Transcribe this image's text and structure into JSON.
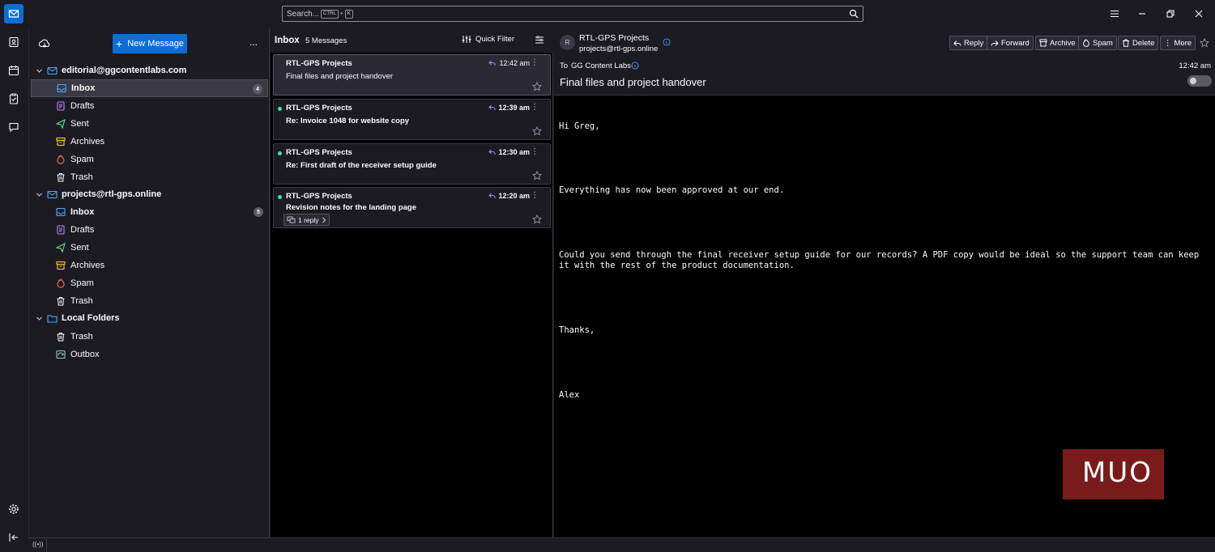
{
  "search": {
    "placeholder": "Search...",
    "kbd_ctrl": "CTRL",
    "kbd_plus": "+",
    "kbd_k": "K"
  },
  "folders_pane": {
    "new_message_label": "New Message",
    "more_label": "...",
    "accounts": [
      {
        "email": "editorial@ggcontentlabs.com",
        "folders": [
          {
            "label": "Inbox",
            "count": "4",
            "icon": "inbox-icon"
          },
          {
            "label": "Drafts",
            "icon": "drafts-icon"
          },
          {
            "label": "Sent",
            "icon": "sent-icon"
          },
          {
            "label": "Archives",
            "icon": "archive-icon"
          },
          {
            "label": "Spam",
            "icon": "spam-icon"
          },
          {
            "label": "Trash",
            "icon": "trash-icon"
          }
        ]
      },
      {
        "email": "projects@rtl-gps.online",
        "folders": [
          {
            "label": "Inbox",
            "count": "5",
            "icon": "inbox-icon"
          },
          {
            "label": "Drafts",
            "icon": "drafts-icon"
          },
          {
            "label": "Sent",
            "icon": "sent-icon"
          },
          {
            "label": "Archives",
            "icon": "archive-icon"
          },
          {
            "label": "Spam",
            "icon": "spam-icon"
          },
          {
            "label": "Trash",
            "icon": "trash-icon"
          }
        ]
      },
      {
        "email": "Local Folders",
        "folders": [
          {
            "label": "Trash",
            "icon": "trash-icon"
          },
          {
            "label": "Outbox",
            "icon": "outbox-icon"
          }
        ]
      }
    ]
  },
  "message_list": {
    "folder_title": "Inbox",
    "count_label": "5 Messages",
    "quick_filter_label": "Quick Filter",
    "messages": [
      {
        "sender": "RTL-GPS Projects",
        "subject": "Final files and project handover",
        "time": "12:42 am",
        "unread": false,
        "selected": true
      },
      {
        "sender": "RTL-GPS Projects",
        "subject": "Re: Invoice 1048 for website copy",
        "time": "12:39 am",
        "unread": true
      },
      {
        "sender": "RTL-GPS Projects",
        "subject": "Re: First draft of the receiver setup guide",
        "time": "12:30 am",
        "unread": true
      },
      {
        "sender": "RTL-GPS Projects",
        "subject": "Revision notes for the landing page",
        "time": "12:20 am",
        "unread": true,
        "thread_label": "1 reply"
      }
    ]
  },
  "reader": {
    "avatar_letter": "R",
    "from_name": "RTL-GPS Projects",
    "from_email": "projects@rtl-gps.online",
    "to_label": "To",
    "to_name": "GG Content Labs",
    "time": "12:42 am",
    "subject": "Final files and project handover",
    "actions": {
      "reply": "Reply",
      "forward": "Forward",
      "archive": "Archive",
      "spam": "Spam",
      "delete": "Delete",
      "more": "More"
    },
    "body_lines": [
      "Hi Greg,",
      "",
      "Everything has now been approved at our end.",
      "",
      "Could you send through the final receiver setup guide for our records? A PDF copy would be ideal so the support team can keep it with the rest of the product documentation.",
      "",
      "Thanks,",
      "",
      "Alex"
    ]
  },
  "watermark": {
    "text": "MUO"
  },
  "colors": {
    "accent": "#0b6ed8",
    "unread_dot": "#3fe1b0",
    "reply_icon": "#a78bfa",
    "verified": "#3b8cf2"
  }
}
